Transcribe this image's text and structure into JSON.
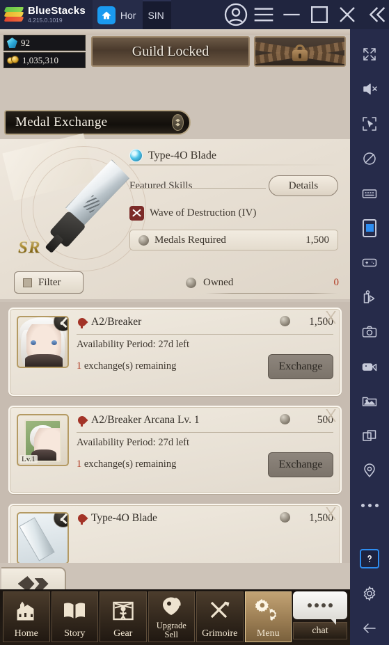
{
  "titlebar": {
    "app_name": "BlueStacks",
    "version": "4.215.0.1019",
    "tabs": [
      {
        "label": "Hor",
        "icon": "home-icon",
        "active": false
      },
      {
        "label": "SIN",
        "icon": "game-avatar-icon",
        "active": true
      }
    ],
    "buttons": [
      {
        "name": "account-icon",
        "label": ""
      },
      {
        "name": "menu-icon",
        "label": ""
      },
      {
        "name": "minimize-icon",
        "label": ""
      },
      {
        "name": "maximize-icon",
        "label": ""
      },
      {
        "name": "close-icon",
        "label": ""
      },
      {
        "name": "collapse-icon",
        "label": ""
      }
    ]
  },
  "game": {
    "currency": {
      "gem_value": "92",
      "gold_value": "1,035,310"
    },
    "guild_banner": "Guild Locked",
    "page_title": "Medal Exchange",
    "featured": {
      "item_name": "Type-4O Blade",
      "rarity": "SR",
      "skills_label": "Featured Skills",
      "details_button": "Details",
      "skill_name": "Wave of Destruction (IV)",
      "medals_required_label": "Medals Required",
      "medals_required_value": "1,500"
    },
    "filter_button": "Filter",
    "owned_label": "Owned",
    "owned_value": "0",
    "exchange_list": [
      {
        "name": "A2/Breaker",
        "price": "1,500",
        "availability": "Availability Period: 27d left",
        "remaining_count": "1",
        "remaining_text": "exchange(s) remaining",
        "button": "Exchange",
        "thumb_type": "character",
        "level_badge": ""
      },
      {
        "name": "A2/Breaker Arcana Lv. 1",
        "price": "500",
        "availability": "Availability Period: 27d left",
        "remaining_count": "1",
        "remaining_text": "exchange(s) remaining",
        "button": "Exchange",
        "thumb_type": "arcana-card",
        "level_badge": "Lv.1"
      },
      {
        "name": "Type-4O Blade",
        "price": "1,500",
        "availability": "",
        "remaining_count": "",
        "remaining_text": "",
        "button": "",
        "thumb_type": "weapon",
        "level_badge": ""
      }
    ],
    "bottom_nav": [
      {
        "label": "Home",
        "icon": "castle-icon",
        "active": false
      },
      {
        "label": "Story",
        "icon": "book-icon",
        "active": false
      },
      {
        "label": "Gear",
        "icon": "gear-puppet-icon",
        "active": false
      },
      {
        "label": "Upgrade Sell",
        "label_line1": "Upgrade",
        "label_line2": "Sell",
        "icon": "upgrade-icon",
        "active": false
      },
      {
        "label": "Grimoire",
        "icon": "quill-sword-icon",
        "active": false
      },
      {
        "label": "Menu",
        "icon": "cogs-icon",
        "active": true
      },
      {
        "label": "chat",
        "icon": "chat-bubble-icon",
        "active": false
      }
    ]
  },
  "sidebar": {
    "items": [
      {
        "name": "fullscreen-icon"
      },
      {
        "name": "mute-icon"
      },
      {
        "name": "cursor-capture-icon"
      },
      {
        "name": "eye-off-icon"
      },
      {
        "name": "keyboard-icon"
      },
      {
        "name": "device-rotate-icon"
      },
      {
        "name": "gamepad-icon"
      },
      {
        "name": "macro-play-icon"
      },
      {
        "name": "screenshot-icon"
      },
      {
        "name": "record-video-icon"
      },
      {
        "name": "media-gallery-icon"
      },
      {
        "name": "multi-instance-icon"
      },
      {
        "name": "location-pin-icon"
      },
      {
        "name": "more-options-icon"
      },
      {
        "name": "help-icon"
      },
      {
        "name": "settings-gear-icon"
      },
      {
        "name": "back-arrow-icon"
      }
    ]
  }
}
